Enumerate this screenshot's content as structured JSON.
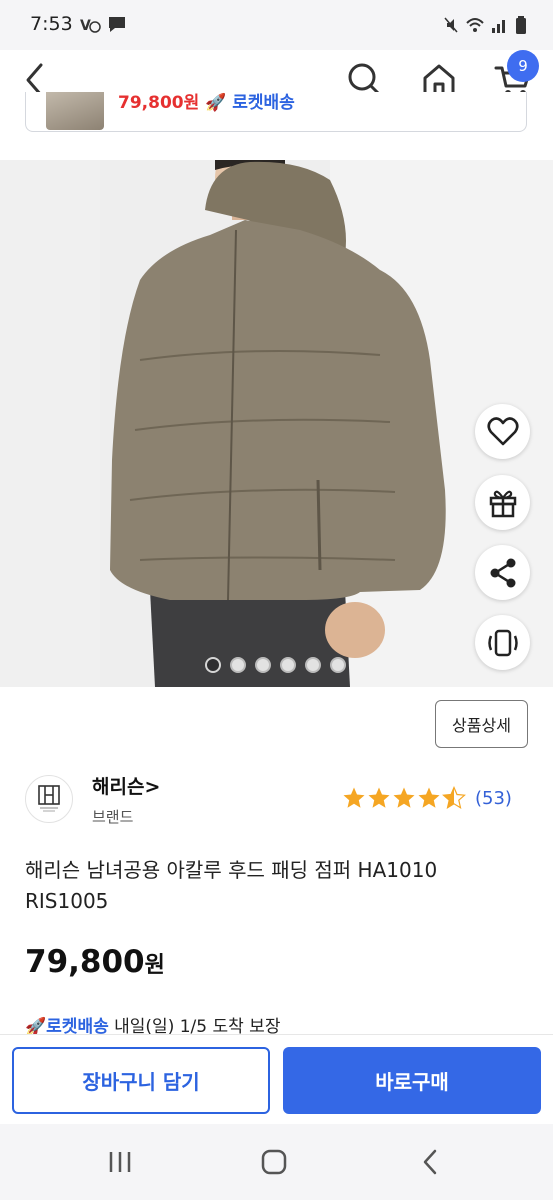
{
  "status_bar": {
    "time": "7:53"
  },
  "header": {
    "cart_count": "9"
  },
  "peek_card": {
    "price": "79,800원",
    "delivery": "로켓배송"
  },
  "colors": {
    "accent": "#3468e6",
    "rocket_blue": "#2c63e0",
    "star": "#f5a623",
    "price_red": "#e63030"
  },
  "product": {
    "detail_button": "상품상세",
    "image_index": 1,
    "image_total": 6,
    "brand": {
      "name": "해리슨>",
      "sub": "브랜드"
    },
    "rating": {
      "stars": 4.5,
      "count": "(53)"
    },
    "title_line1": "해리슨 남녀공용 아칼루 후드 패딩 점퍼 HA1010",
    "title_line2": "RIS1005",
    "price": "79,800",
    "price_unit": "원",
    "delivery": {
      "rocket": "로켓배송",
      "text": " 내일(일) 1/5 도착 보장"
    }
  },
  "bottom_bar": {
    "cart_button": "장바구니 담기",
    "buy_button": "바로구매"
  },
  "icons": [
    "back-arrow-icon",
    "search-icon",
    "home-icon",
    "cart-icon",
    "heart-icon",
    "gift-icon",
    "share-icon",
    "vibrate-icon",
    "rocket-icon",
    "star-icon",
    "recent-apps-icon",
    "home-nav-icon",
    "back-nav-icon"
  ]
}
